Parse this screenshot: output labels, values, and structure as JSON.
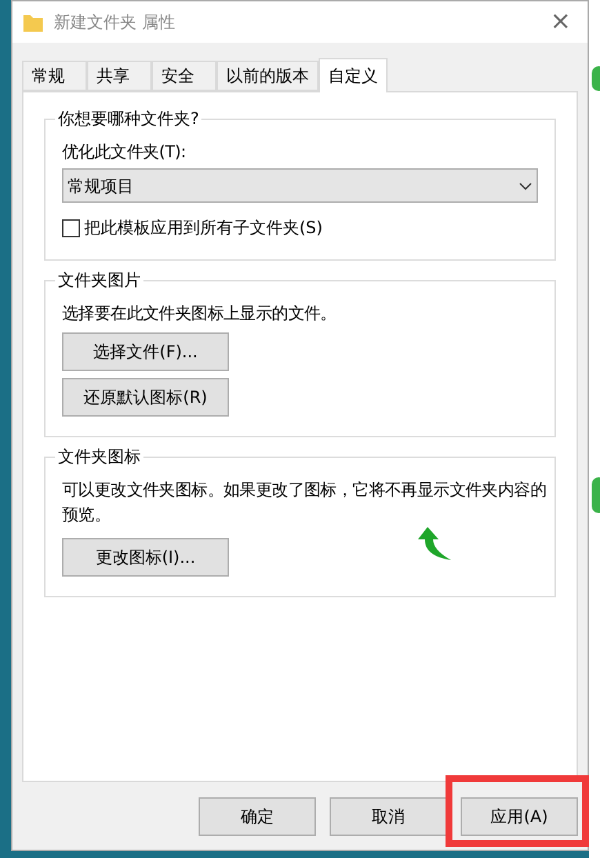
{
  "window": {
    "title": "新建文件夹 属性",
    "close": "×"
  },
  "tabs": [
    {
      "label": "常规",
      "selected": false
    },
    {
      "label": "共享",
      "selected": false
    },
    {
      "label": "安全",
      "selected": false
    },
    {
      "label": "以前的版本",
      "selected": false
    },
    {
      "label": "自定义",
      "selected": true
    }
  ],
  "groups": [
    {
      "title": "你想要哪种文件夹?",
      "items": [
        {
          "kind": "label",
          "text": "优化此文件夹(T):"
        },
        {
          "kind": "dropdown",
          "value": "常规项目"
        },
        {
          "kind": "checkbox",
          "label": "把此模板应用到所有子文件夹(S)",
          "checked": false
        }
      ]
    },
    {
      "title": "文件夹图片",
      "items": [
        {
          "kind": "label",
          "text": "选择要在此文件夹图标上显示的文件。"
        },
        {
          "kind": "button",
          "label": "选择文件(F)..."
        },
        {
          "kind": "button",
          "label": "还原默认图标(R)"
        }
      ]
    },
    {
      "title": "文件夹图标",
      "items": [
        {
          "kind": "label",
          "text": "可以更改文件夹图标。如果更改了图标，它将不再显示文件夹内容的预览。"
        },
        {
          "kind": "button_with_preview",
          "label": "更改图标(I)..."
        }
      ]
    }
  ],
  "buttons": [
    {
      "label": "确定",
      "highlighted": false
    },
    {
      "label": "取消",
      "highlighted": false
    },
    {
      "label": "应用(A)",
      "highlighted": true
    }
  ]
}
